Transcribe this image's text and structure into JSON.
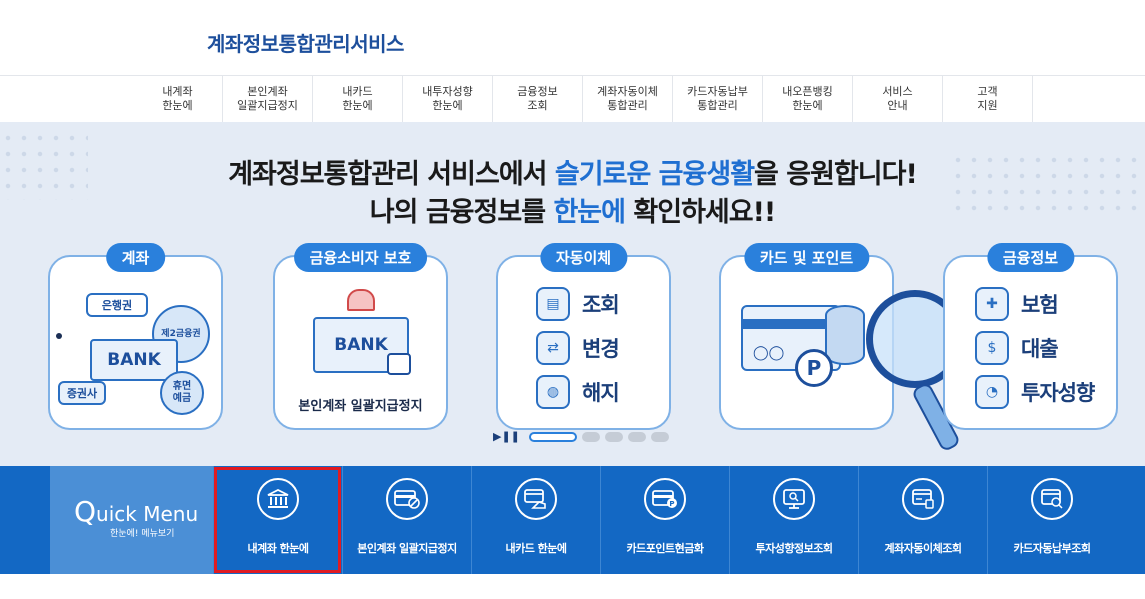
{
  "header": {
    "logo": "계좌정보통합관리서비스"
  },
  "gnb": [
    {
      "line1": "내계좌",
      "line2": "한눈에"
    },
    {
      "line1": "본인계좌",
      "line2": "일괄지급정지"
    },
    {
      "line1": "내카드",
      "line2": "한눈에"
    },
    {
      "line1": "내투자성향",
      "line2": "한눈에"
    },
    {
      "line1": "금융정보",
      "line2": "조회"
    },
    {
      "line1": "계좌자동이체",
      "line2": "통합관리"
    },
    {
      "line1": "카드자동납부",
      "line2": "통합관리"
    },
    {
      "line1": "내오픈뱅킹",
      "line2": "한눈에"
    },
    {
      "line1": "서비스",
      "line2": "안내"
    },
    {
      "line1": "고객",
      "line2": "지원"
    }
  ],
  "hero": {
    "line1_a": "계좌정보통합관리 서비스에서 ",
    "line1_hl": "슬기로운 금융생활",
    "line1_b": "을 응원합니다!",
    "line2_a": "나의 금융정보를 ",
    "line2_hl": "한눈에",
    "line2_b": " 확인하세요!!"
  },
  "cards": {
    "account": {
      "tag": "계좌",
      "bubble1": "은행권",
      "bubble2": "제2금융권",
      "bank": "BANK",
      "circle1": "증권사",
      "circle2": "휴면\n예금"
    },
    "protect": {
      "tag": "금융소비자 보호",
      "bank": "BANK",
      "caption": "본인계좌 일괄지급정지"
    },
    "autotransfer": {
      "tag": "자동이체",
      "items": [
        "조회",
        "변경",
        "해지"
      ]
    },
    "cardpoint": {
      "tag": "카드 및 포인트",
      "p_letter": "P"
    },
    "fininfo": {
      "tag": "금융정보",
      "items": [
        "보험",
        "대출",
        "투자성향"
      ]
    }
  },
  "pager": {
    "play_pause": "▶❚❚",
    "total": 5,
    "active": 1
  },
  "quick_menu": {
    "title": "uick Menu",
    "title_q": "Q",
    "subtitle": "한눈에! 메뉴보기",
    "items": [
      {
        "label": "내계좌 한눈에",
        "icon": "bank-building-icon"
      },
      {
        "label": "본인계좌 일괄지급정지",
        "icon": "card-block-icon"
      },
      {
        "label": "내카드 한눈에",
        "icon": "card-hand-icon"
      },
      {
        "label": "카드포인트현금화",
        "icon": "card-point-icon"
      },
      {
        "label": "투자성향정보조회",
        "icon": "monitor-search-icon"
      },
      {
        "label": "계좌자동이체조회",
        "icon": "card-stack-icon"
      },
      {
        "label": "카드자동납부조회",
        "icon": "card-search-icon"
      }
    ]
  },
  "colors": {
    "primary": "#1368c4",
    "accent_blue": "#2a80dc",
    "highlight_red": "#e01b22",
    "hero_bg": "#e4ebf5"
  }
}
